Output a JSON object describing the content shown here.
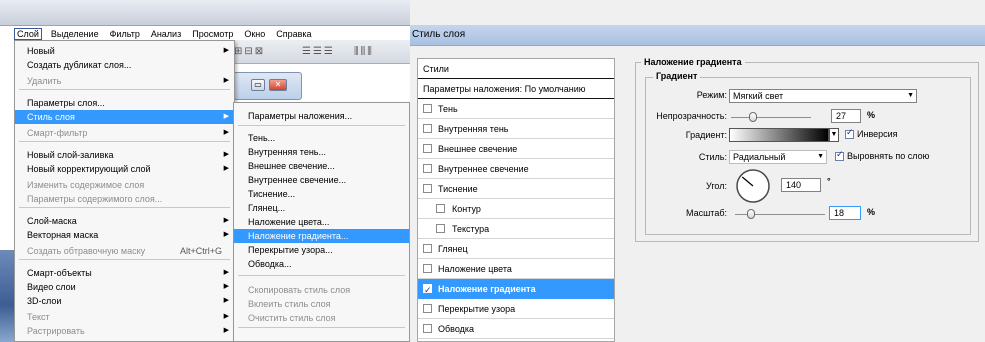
{
  "menubar": [
    "Слой",
    "Выделение",
    "Фильтр",
    "Анализ",
    "Просмотр",
    "Окно",
    "Справка"
  ],
  "layer_menu": {
    "items": [
      {
        "label": "Новый",
        "arrow": true,
        "disabled": false
      },
      {
        "label": "Создать дубликат слоя...",
        "arrow": false,
        "disabled": false
      },
      {
        "label": "Удалить",
        "arrow": true,
        "disabled": true
      },
      {
        "label": "Параметры слоя...",
        "arrow": false,
        "disabled": false
      },
      {
        "label": "Стиль слоя",
        "arrow": true,
        "disabled": false,
        "highlighted": true
      },
      {
        "label": "Смарт-фильтр",
        "arrow": true,
        "disabled": true
      },
      {
        "label": "Новый слой-заливка",
        "arrow": true,
        "disabled": false
      },
      {
        "label": "Новый корректирующий слой",
        "arrow": true,
        "disabled": false
      },
      {
        "label": "Изменить содержимое слоя",
        "arrow": false,
        "disabled": true
      },
      {
        "label": "Параметры содержимого слоя...",
        "arrow": false,
        "disabled": true
      },
      {
        "label": "Слой-маска",
        "arrow": true,
        "disabled": false
      },
      {
        "label": "Векторная маска",
        "arrow": true,
        "disabled": false
      },
      {
        "label": "Создать обтравочную маску",
        "shortcut": "Alt+Ctrl+G",
        "arrow": false,
        "disabled": true
      },
      {
        "label": "Смарт-объекты",
        "arrow": true,
        "disabled": false
      },
      {
        "label": "Видео слои",
        "arrow": true,
        "disabled": false
      },
      {
        "label": "3D-слои",
        "arrow": true,
        "disabled": false
      },
      {
        "label": "Текст",
        "arrow": true,
        "disabled": true
      },
      {
        "label": "Растрировать",
        "arrow": true,
        "disabled": true
      }
    ]
  },
  "style_submenu": {
    "items": [
      {
        "label": "Параметры наложения...",
        "disabled": false
      },
      {
        "label": "Тень...",
        "disabled": false
      },
      {
        "label": "Внутренняя тень...",
        "disabled": false
      },
      {
        "label": "Внешнее свечение...",
        "disabled": false
      },
      {
        "label": "Внутреннее свечение...",
        "disabled": false
      },
      {
        "label": "Тиснение...",
        "disabled": false
      },
      {
        "label": "Глянец...",
        "disabled": false
      },
      {
        "label": "Наложение цвета...",
        "disabled": false
      },
      {
        "label": "Наложение градиента...",
        "disabled": false,
        "highlighted": true
      },
      {
        "label": "Перекрытие узора...",
        "disabled": false
      },
      {
        "label": "Обводка...",
        "disabled": false
      },
      {
        "label": "Скопировать стиль слоя",
        "disabled": true
      },
      {
        "label": "Вклеить стиль слоя",
        "disabled": true
      },
      {
        "label": "Очистить стиль слоя",
        "disabled": true
      }
    ]
  },
  "dialog": {
    "title": "Стиль слоя",
    "styles_header": "Стили",
    "blend_header": "Параметры наложения: По умолчанию",
    "styles": [
      {
        "label": "Тень",
        "checked": false
      },
      {
        "label": "Внутренняя тень",
        "checked": false
      },
      {
        "label": "Внешнее свечение",
        "checked": false
      },
      {
        "label": "Внутреннее свечение",
        "checked": false
      },
      {
        "label": "Тиснение",
        "checked": false
      },
      {
        "label": "Контур",
        "checked": false,
        "sub": true
      },
      {
        "label": "Текстура",
        "checked": false,
        "sub": true
      },
      {
        "label": "Глянец",
        "checked": false
      },
      {
        "label": "Наложение цвета",
        "checked": false
      },
      {
        "label": "Наложение градиента",
        "checked": true,
        "selected": true
      },
      {
        "label": "Перекрытие узора",
        "checked": false
      },
      {
        "label": "Обводка",
        "checked": false
      }
    ],
    "panel": {
      "section_title": "Наложение градиента",
      "group_title": "Градиент",
      "mode_label": "Режим:",
      "mode_value": "Мягкий свет",
      "opacity_label": "Непрозрачность:",
      "opacity_value": "27",
      "opacity_unit": "%",
      "opacity_fraction": 0.27,
      "gradient_label": "Градиент:",
      "invert_label": "Инверсия",
      "invert_checked": true,
      "style_label": "Стиль:",
      "style_value": "Радиальный",
      "align_label": "Выровнять по слою",
      "align_checked": true,
      "angle_label": "Угол:",
      "angle_value": "140",
      "angle_unit": "°",
      "scale_label": "Масштаб:",
      "scale_value": "18",
      "scale_unit": "%",
      "scale_fraction": 0.18
    }
  },
  "colors": {
    "highlight": "#3399ff",
    "title_bar": "#b8cbe8"
  }
}
